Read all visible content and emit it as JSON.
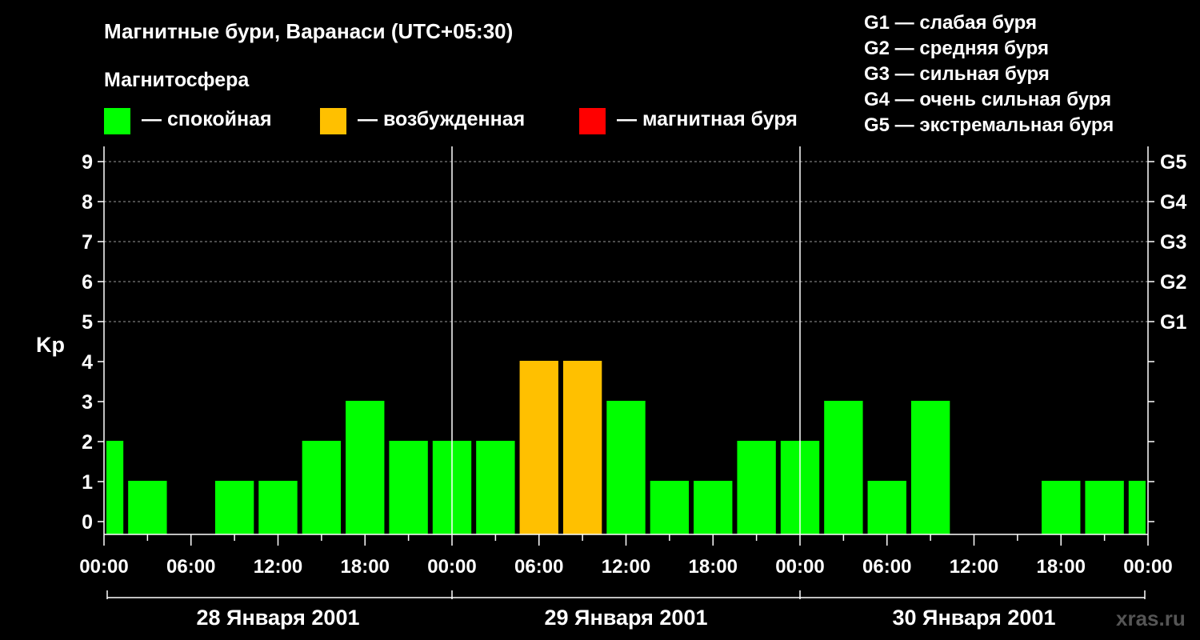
{
  "title": "Магнитные бури, Варанаси (UTC+05:30)",
  "legend": {
    "heading": "Магнитосфера",
    "items": [
      {
        "label": "— спокойная",
        "color": "#00ff00"
      },
      {
        "label": "— возбужденная",
        "color": "#ffc000"
      },
      {
        "label": "— магнитная буря",
        "color": "#ff0000"
      }
    ]
  },
  "g_scale": [
    "G1 — слабая буря",
    "G2 — средняя буря",
    "G3 — сильная буря",
    "G4 — очень сильная буря",
    "G5 — экстремальная буря"
  ],
  "brand": "xras.ru",
  "chart_data": {
    "type": "bar",
    "ylabel": "Kp",
    "ylim": [
      0,
      9
    ],
    "yticks": [
      0,
      1,
      2,
      3,
      4,
      5,
      6,
      7,
      8,
      9
    ],
    "right_axis_labels": [
      {
        "kp": 5,
        "label": "G1"
      },
      {
        "kp": 6,
        "label": "G2"
      },
      {
        "kp": 7,
        "label": "G3"
      },
      {
        "kp": 8,
        "label": "G4"
      },
      {
        "kp": 9,
        "label": "G5"
      }
    ],
    "x_tick_labels": [
      "00:00",
      "06:00",
      "12:00",
      "18:00",
      "00:00",
      "06:00",
      "12:00",
      "18:00",
      "00:00",
      "06:00",
      "12:00",
      "18:00",
      "00:00"
    ],
    "days": [
      "28 Января 2001",
      "29 Января 2001",
      "30 Января 2001"
    ],
    "x_unit": "3-hour intervals from 28 Января 2001 00:00",
    "bars": [
      {
        "start_h": 0,
        "end_h": 1.5,
        "kp": 2,
        "color": "#00ff00"
      },
      {
        "start_h": 1.5,
        "end_h": 4.5,
        "kp": 1,
        "color": "#00ff00"
      },
      {
        "start_h": 4.5,
        "end_h": 7.5,
        "kp": 0,
        "color": "#00ff00"
      },
      {
        "start_h": 7.5,
        "end_h": 10.5,
        "kp": 1,
        "color": "#00ff00"
      },
      {
        "start_h": 10.5,
        "end_h": 13.5,
        "kp": 1,
        "color": "#00ff00"
      },
      {
        "start_h": 13.5,
        "end_h": 16.5,
        "kp": 2,
        "color": "#00ff00"
      },
      {
        "start_h": 16.5,
        "end_h": 19.5,
        "kp": 3,
        "color": "#00ff00"
      },
      {
        "start_h": 19.5,
        "end_h": 22.5,
        "kp": 2,
        "color": "#00ff00"
      },
      {
        "start_h": 22.5,
        "end_h": 25.5,
        "kp": 2,
        "color": "#00ff00"
      },
      {
        "start_h": 25.5,
        "end_h": 28.5,
        "kp": 2,
        "color": "#00ff00"
      },
      {
        "start_h": 28.5,
        "end_h": 31.5,
        "kp": 4,
        "color": "#ffc000"
      },
      {
        "start_h": 31.5,
        "end_h": 34.5,
        "kp": 4,
        "color": "#ffc000"
      },
      {
        "start_h": 34.5,
        "end_h": 37.5,
        "kp": 3,
        "color": "#00ff00"
      },
      {
        "start_h": 37.5,
        "end_h": 40.5,
        "kp": 1,
        "color": "#00ff00"
      },
      {
        "start_h": 40.5,
        "end_h": 43.5,
        "kp": 1,
        "color": "#00ff00"
      },
      {
        "start_h": 43.5,
        "end_h": 46.5,
        "kp": 2,
        "color": "#00ff00"
      },
      {
        "start_h": 46.5,
        "end_h": 49.5,
        "kp": 2,
        "color": "#00ff00"
      },
      {
        "start_h": 49.5,
        "end_h": 52.5,
        "kp": 3,
        "color": "#00ff00"
      },
      {
        "start_h": 52.5,
        "end_h": 55.5,
        "kp": 1,
        "color": "#00ff00"
      },
      {
        "start_h": 55.5,
        "end_h": 58.5,
        "kp": 3,
        "color": "#00ff00"
      },
      {
        "start_h": 58.5,
        "end_h": 61.5,
        "kp": 0,
        "color": "#00ff00"
      },
      {
        "start_h": 61.5,
        "end_h": 64.5,
        "kp": 0,
        "color": "#00ff00"
      },
      {
        "start_h": 64.5,
        "end_h": 67.5,
        "kp": 1,
        "color": "#00ff00"
      },
      {
        "start_h": 67.5,
        "end_h": 70.5,
        "kp": 1,
        "color": "#00ff00"
      },
      {
        "start_h": 70.5,
        "end_h": 72,
        "kp": 1,
        "color": "#00ff00"
      }
    ],
    "grid": "dashed horizontal at each Kp level 5–9, vertical solid lines at day boundaries",
    "legend_position": "top"
  }
}
